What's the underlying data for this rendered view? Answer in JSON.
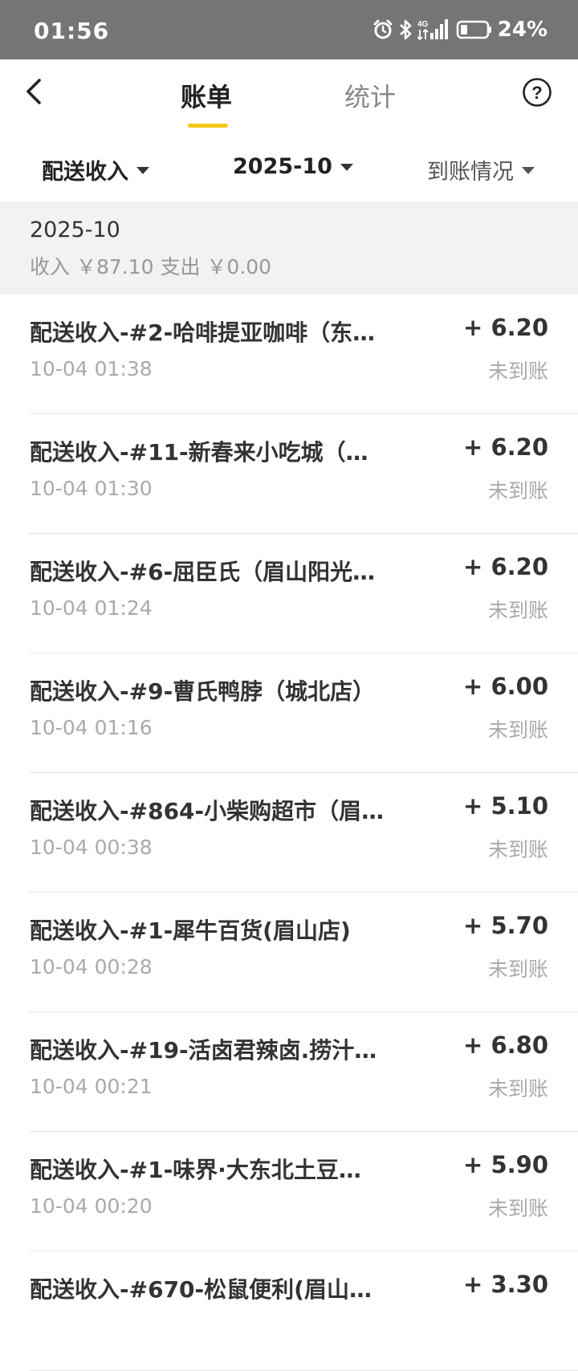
{
  "status_bar": {
    "time": "01:56",
    "network": "4G",
    "battery_percent": "24%",
    "icons": [
      "alarm-icon",
      "bluetooth-icon",
      "signal-icon",
      "battery-icon"
    ]
  },
  "header": {
    "tabs": [
      {
        "label": "账单",
        "active": true
      },
      {
        "label": "统计",
        "active": false
      }
    ],
    "help_icon": "?",
    "accent_color": "#f5c518"
  },
  "filters": {
    "type": "配送收入",
    "month": "2025-10",
    "status": "到账情况"
  },
  "summary": {
    "month": "2025-10",
    "totals": "收入 ￥87.10 支出 ￥0.00"
  },
  "records": [
    {
      "title": "配送收入-#2-哈啡提亚咖啡（东…",
      "time": "10-04 01:38",
      "amount": "+ 6.20",
      "status": "未到账"
    },
    {
      "title": "配送收入-#11-新春来小吃城（…",
      "time": "10-04 01:30",
      "amount": "+ 6.20",
      "status": "未到账"
    },
    {
      "title": "配送收入-#6-屈臣氏（眉山阳光…",
      "time": "10-04 01:24",
      "amount": "+ 6.20",
      "status": "未到账"
    },
    {
      "title": "配送收入-#9-曹氏鸭脖（城北店）",
      "time": "10-04 01:16",
      "amount": "+ 6.00",
      "status": "未到账"
    },
    {
      "title": "配送收入-#864-小柴购超市（眉…",
      "time": "10-04 00:38",
      "amount": "+ 5.10",
      "status": "未到账"
    },
    {
      "title": "配送收入-#1-犀牛百货(眉山店)",
      "time": "10-04 00:28",
      "amount": "+ 5.70",
      "status": "未到账"
    },
    {
      "title": "配送收入-#19-活卤君辣卤.捞汁…",
      "time": "10-04 00:21",
      "amount": "+ 6.80",
      "status": "未到账"
    },
    {
      "title": "配送收入-#1-味界·大东北土豆…",
      "time": "10-04 00:20",
      "amount": "+ 5.90",
      "status": "未到账"
    },
    {
      "title": "配送收入-#670-松鼠便利(眉山…",
      "time": "",
      "amount": "+ 3.30",
      "status": ""
    }
  ]
}
